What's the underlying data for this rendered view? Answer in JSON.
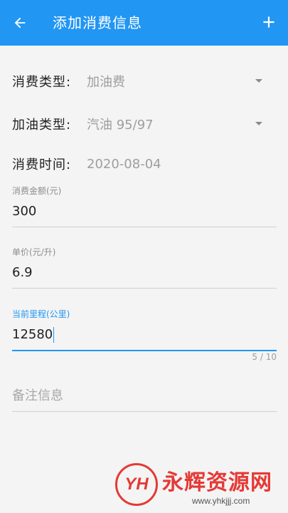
{
  "appbar": {
    "title": "添加消费信息",
    "back_icon": "arrow-left-icon",
    "add_icon": "plus-icon",
    "background": "#2196f3"
  },
  "form": {
    "consume_type": {
      "label": "消费类型:",
      "value": "加油费"
    },
    "fuel_type": {
      "label": "加油类型:",
      "value": "汽油 95/97"
    },
    "consume_time": {
      "label": "消费时间:",
      "value": "2020-08-04"
    },
    "amount": {
      "label": "消费金额(元)",
      "value": "300"
    },
    "unit_price": {
      "label": "单价(元/升)",
      "value": "6.9"
    },
    "mileage": {
      "label": "当前里程(公里)",
      "value": "12580",
      "counter": "5 / 10"
    },
    "remark": {
      "placeholder": "备注信息"
    }
  },
  "watermark": {
    "logo": "YH",
    "text": "永辉资源网",
    "url": "www.yhkjjj.com"
  }
}
